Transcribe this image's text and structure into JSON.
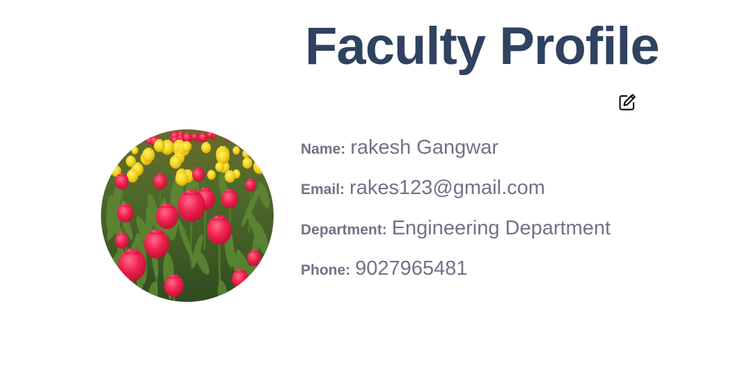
{
  "header": {
    "title": "Faculty Profile"
  },
  "actions": {
    "edit_icon": "edit-icon"
  },
  "avatar": {
    "image": "tulip-field-photo"
  },
  "profile": {
    "name_label": "Name:",
    "name_value": "rakesh Gangwar",
    "email_label": "Email:",
    "email_value": "rakes123@gmail.com",
    "department_label": "Department:",
    "department_value": "Engineering Department",
    "phone_label": "Phone:",
    "phone_value": "9027965481"
  },
  "colors": {
    "title": "#2f4260",
    "text": "#6f7386",
    "background": "#ffffff"
  }
}
